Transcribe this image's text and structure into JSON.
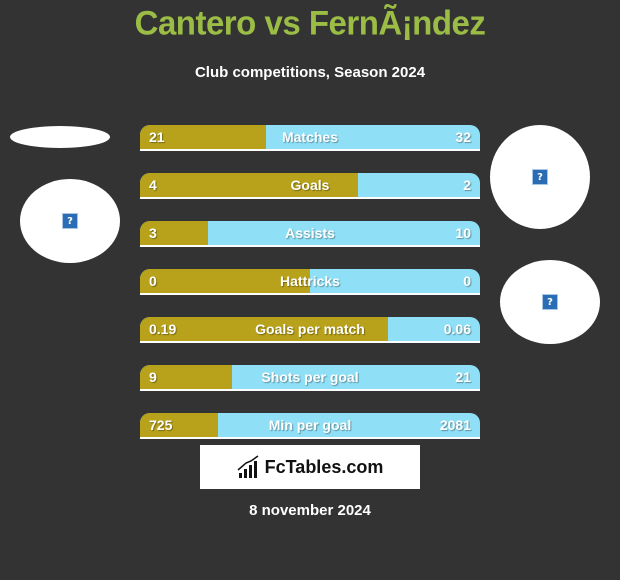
{
  "header": {
    "title": "Cantero vs FernÃ¡ndez",
    "subtitle": "Club competitions, Season 2024"
  },
  "colors": {
    "left_player": "#b8a21b",
    "right_player": "#8fe0f7",
    "title": "#9bbd45",
    "background": "#333333"
  },
  "chart_data": {
    "type": "bar",
    "title": "Cantero vs FernÃ¡ndez",
    "subtitle": "Club competitions, Season 2024",
    "orientation": "horizontal-comparison",
    "series": [
      {
        "name": "Cantero",
        "side": "left"
      },
      {
        "name": "FernÃ¡ndez",
        "side": "right"
      }
    ],
    "rows": [
      {
        "label": "Matches",
        "left": "21",
        "right": "32",
        "left_share": 0.37
      },
      {
        "label": "Goals",
        "left": "4",
        "right": "2",
        "left_share": 0.64
      },
      {
        "label": "Assists",
        "left": "3",
        "right": "10",
        "left_share": 0.2
      },
      {
        "label": "Hattricks",
        "left": "0",
        "right": "0",
        "left_share": 0.5
      },
      {
        "label": "Goals per match",
        "left": "0.19",
        "right": "0.06",
        "left_share": 0.73
      },
      {
        "label": "Shots per goal",
        "left": "9",
        "right": "21",
        "left_share": 0.27
      },
      {
        "label": "Min per goal",
        "left": "725",
        "right": "2081",
        "left_share": 0.23
      }
    ]
  },
  "footer": {
    "logo_text": "FcTables.com",
    "date": "8 november 2024"
  },
  "icons": {
    "missing_image": "?"
  }
}
